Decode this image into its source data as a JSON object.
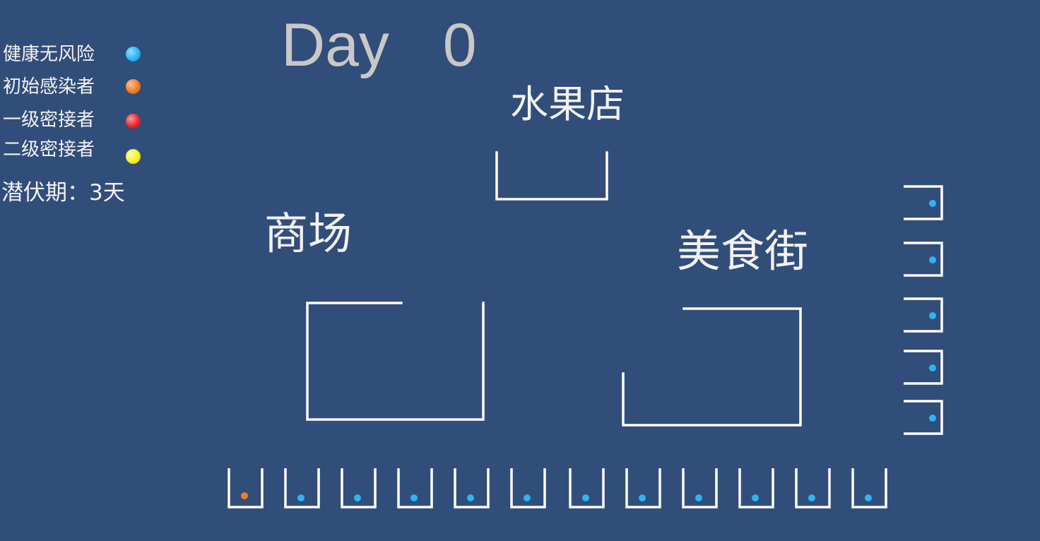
{
  "legend": {
    "items": [
      {
        "label": "健康无风险",
        "color": "#2bb5f5"
      },
      {
        "label": "初始感染者",
        "color": "#f07b2a"
      },
      {
        "label": "一级密接者",
        "color": "#e8262c"
      },
      {
        "label": "二级密接者",
        "color": "#f6f21f"
      }
    ],
    "incubation": "潜伏期：3天"
  },
  "day_label": "Day  0",
  "places": {
    "fruit_store": "水果店",
    "mall": "商场",
    "food_street": "美食街"
  },
  "colors": {
    "background": "#314d79",
    "walls": "#ffffff",
    "healthy": "#2bb5f5",
    "initial_infected": "#f07b2a"
  },
  "homes": {
    "bottom_row_status": [
      "initial_infected",
      "healthy",
      "healthy",
      "healthy",
      "healthy",
      "healthy",
      "healthy",
      "healthy",
      "healthy",
      "healthy",
      "healthy",
      "healthy"
    ],
    "right_column_status": [
      "healthy",
      "healthy",
      "healthy",
      "healthy",
      "healthy"
    ]
  }
}
